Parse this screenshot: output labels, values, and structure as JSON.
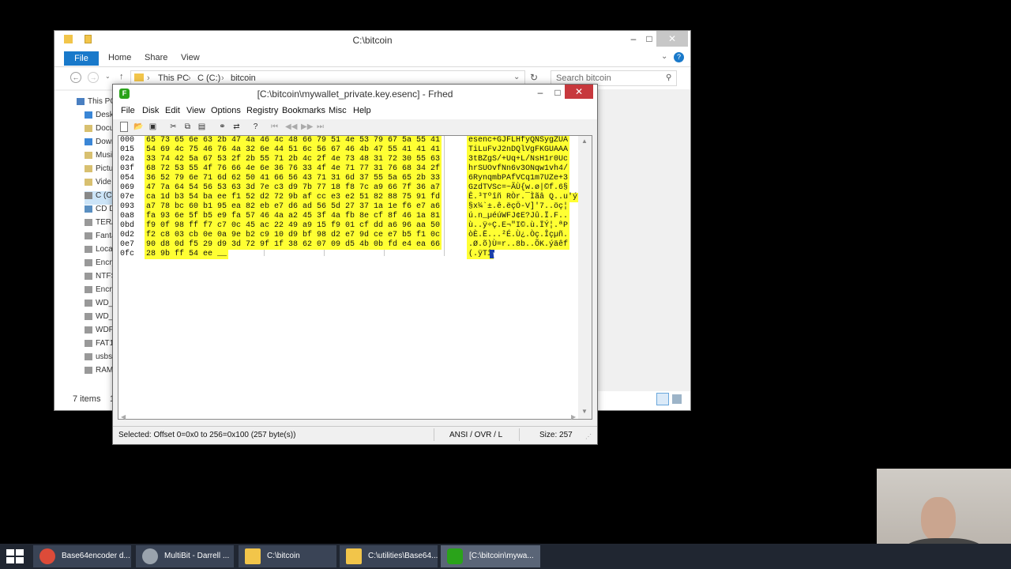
{
  "explorer": {
    "title": "C:\\bitcoin",
    "tabs": {
      "file": "File",
      "home": "Home",
      "share": "Share",
      "view": "View"
    },
    "breadcrumbs": [
      "This PC",
      "C (C:)",
      "bitcoin"
    ],
    "search_placeholder": "Search bitcoin",
    "nav_items": [
      "This PC",
      "Desk",
      "Docu",
      "Dowr",
      "Musi",
      "Pictu",
      "Vide",
      "C (C:",
      "CD D",
      "TERA",
      "Fanta",
      "Loca",
      "Encry",
      "NTFS",
      "Encry",
      "WD_1",
      "WD_2",
      "WDP",
      "FAT1",
      "usbs",
      "RAM"
    ],
    "status_items": "7 items",
    "status_extra": "1"
  },
  "frhed": {
    "title": "[C:\\bitcoin\\mywallet_private.key.esenc] - Frhed",
    "menus": [
      "File",
      "Disk",
      "Edit",
      "View",
      "Options",
      "Registry",
      "Bookmarks",
      "Misc",
      "Help"
    ],
    "rows": [
      {
        "offset": "000",
        "hex": "65 73 65 6e 63 2b 47 4a 46 4c 48 66 79 51 4e 53 79 67 5a 55 41",
        "ascii": "esenc+GJFLHfyQNSygZUA"
      },
      {
        "offset": "015",
        "hex": "54 69 4c 75 46 76 4a 32 6e 44 51 6c 56 67 46 4b 47 55 41 41 41",
        "ascii": "TiLuFvJ2nDQlVgFKGUAAA"
      },
      {
        "offset": "02a",
        "hex": "33 74 42 5a 67 53 2f 2b 55 71 2b 4c 2f 4e 73 48 31 72 30 55 63",
        "ascii": "3tBZgS/+Uq+L/NsH1r0Uc"
      },
      {
        "offset": "03f",
        "hex": "68 72 53 55 4f 76 66 4e 6e 36 76 33 4f 4e 71 77 31 76 68 34 2f",
        "ascii": "hrSUOvfNn6v3ONqw1vh4/"
      },
      {
        "offset": "054",
        "hex": "36 52 79 6e 71 6d 62 50 41 66 56 43 71 31 6d 37 55 5a 65 2b 33",
        "ascii": "6RynqmbPAfVCq1m7UZe+3"
      },
      {
        "offset": "069",
        "hex": "47 7a 64 54 56 53 63 3d 7e c3 d9 7b 77 18 f8 7c a9 66 7f 36 a7",
        "ascii": "GzdTVSc=~ÃÙ{w.ø|©f.6§"
      },
      {
        "offset": "07e",
        "hex": "ca 1d b3 54 ba ee f1 52 d2 72 9b af cc e3 e2 51 82 88 75 91 fd",
        "ascii": "Ê.³Tºîñ RÒr.¯Ìãâ Q..u'ý"
      },
      {
        "offset": "093",
        "hex": "a7 78 bc 60 b1 95 ea 82 eb e7 d6 ad 56 5d 27 37 1a 1e f6 e7 a6",
        "ascii": "§x¼`±.ê.ëçÖ-V]'7..öç¦"
      },
      {
        "offset": "0a8",
        "hex": "fa 93 6e 5f b5 e9 fa 57 46 4a a2 45 3f 4a fb 8e cf 8f 46 1a 81",
        "ascii": "ú.n_µéúWFJ¢E?Jû.Ï.F.."
      },
      {
        "offset": "0bd",
        "hex": "f9 0f 98 ff f7 c7 0c 45 ac 22 49 a9 15 f9 01 cf dd a6 96 aa 50",
        "ascii": "ù..ÿ÷Ç.E¬\"I©.ù.ÏÝ¦.ªP"
      },
      {
        "offset": "0d2",
        "hex": "f2 c8 03 cb 0e 0a 9e b2 c9 10 d9 bf 98 d2 e7 9d ce e7 b5 f1 0c",
        "ascii": "òÈ.Ë...²É.Ù¿.Òç.Îçµñ."
      },
      {
        "offset": "0e7",
        "hex": "90 d8 0d f5 29 d9 3d 72 9f 1f 38 62 07 09 d5 4b 0b fd e4 ea 66",
        "ascii": ".Ø.õ)Ù=r..8b..ÕK.ýäêf"
      },
      {
        "offset": "0fc",
        "hex": "28 9b ff 54 ee __",
        "ascii": "(.ÿTî"
      }
    ],
    "status_selected": "Selected: Offset 0=0x0 to 256=0x100 (257 byte(s))",
    "status_mode": "ANSI / OVR / L",
    "status_size": "Size: 257"
  },
  "taskbar": {
    "items": [
      {
        "label": "Base64encoder d...",
        "icon": "chrome-icon",
        "color": "#dd4b39"
      },
      {
        "label": "MultiBit - Darrell ...",
        "icon": "bitcoin-icon",
        "color": "#9aa3ad"
      },
      {
        "label": "C:\\bitcoin",
        "icon": "folder-icon",
        "color": "#f2c54a"
      },
      {
        "label": "C:\\utilities\\Base64...",
        "icon": "folder-icon",
        "color": "#f2c54a"
      },
      {
        "label": "[C:\\bitcoin\\mywa...",
        "icon": "frhed-icon",
        "color": "#2aa31a"
      }
    ]
  },
  "colors": {
    "selection": "#ffff33",
    "accent": "#1979ca",
    "taskbar": "#202631"
  }
}
